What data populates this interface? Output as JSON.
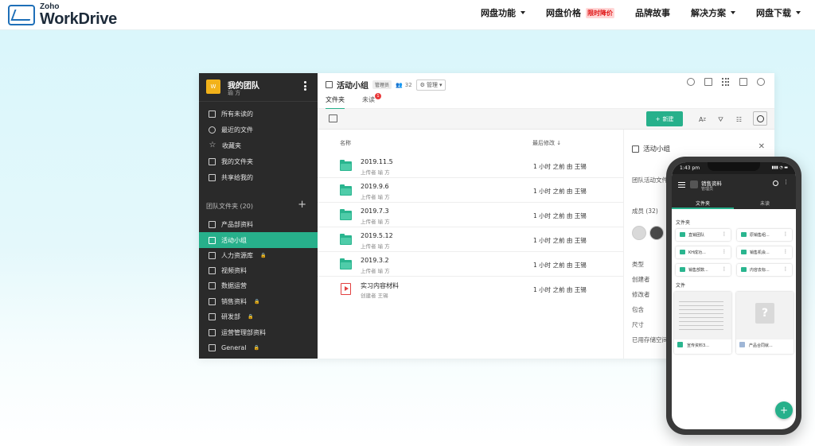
{
  "header": {
    "logo_small": "Zoho",
    "logo_big": "WorkDrive",
    "nav": [
      {
        "label": "网盘功能",
        "has_caret": true
      },
      {
        "label": "网盘价格",
        "badge": "限时降价"
      },
      {
        "label": "品牌故事"
      },
      {
        "label": "解决方案",
        "has_caret": true
      },
      {
        "label": "网盘下载",
        "has_caret": true
      }
    ]
  },
  "app": {
    "team": {
      "avatar": "W",
      "name": "我的团队",
      "sub": "瑜 方"
    },
    "sidebar_items": [
      {
        "label": "所有未读的",
        "icon": "inbox-icon"
      },
      {
        "label": "最近的文件",
        "icon": "clock-icon"
      },
      {
        "label": "收藏夹",
        "icon": "star-icon"
      },
      {
        "label": "我的文件夹",
        "icon": "folder-icon"
      },
      {
        "label": "共享给我的",
        "icon": "share-icon"
      }
    ],
    "team_section": "团队文件夹 (20)",
    "team_folders": [
      {
        "label": "产品部资料",
        "locked": false
      },
      {
        "label": "活动小组",
        "locked": false,
        "active": true
      },
      {
        "label": "人力资源库",
        "locked": true
      },
      {
        "label": "视频资料",
        "locked": false
      },
      {
        "label": "数据运营",
        "locked": false
      },
      {
        "label": "销售资料",
        "locked": true
      },
      {
        "label": "研发部",
        "locked": true
      },
      {
        "label": "运营管理部资料",
        "locked": false
      },
      {
        "label": "General",
        "locked": true
      }
    ],
    "main": {
      "title": "活动小组",
      "role_tag": "管理员",
      "member_count": "32",
      "manage_label": "管理",
      "tabs": [
        {
          "label": "文件夹",
          "active": true
        },
        {
          "label": "未读",
          "badge": "1"
        }
      ],
      "new_button": "新建",
      "col_name": "名称",
      "col_modified": "最后修改",
      "rows": [
        {
          "name": "2019.11.5",
          "sub": "上传者 瑜 方",
          "modified": "1 小时 之前 由 王锡",
          "type": "folder"
        },
        {
          "name": "2019.9.6",
          "sub": "上传者 瑜 方",
          "modified": "1 小时 之前 由 王锡",
          "type": "folder"
        },
        {
          "name": "2019.7.3",
          "sub": "上传者 瑜 方",
          "modified": "1 小时 之前 由 王锡",
          "type": "folder"
        },
        {
          "name": "2019.5.12",
          "sub": "上传者 瑜 方",
          "modified": "1 小时 之前 由 王锡",
          "type": "folder"
        },
        {
          "name": "2019.3.2",
          "sub": "上传者 瑜 方",
          "modified": "1 小时 之前 由 王锡",
          "type": "folder"
        },
        {
          "name": "实习内容材料",
          "sub": "创建者 王锡",
          "modified": "1 小时 之前 由 王锡",
          "type": "video"
        }
      ]
    },
    "detail": {
      "title": "活动小组",
      "desc": "团队活动文件",
      "members": "成员 (32)",
      "fields": [
        "类型",
        "创建者",
        "修改者",
        "包含",
        "尺寸",
        "已用存储空间"
      ]
    }
  },
  "phone": {
    "time": "1:43 pm",
    "signal": "▮▮▮ ◔ ▬",
    "title": "销售资料",
    "sub": "管理员",
    "tabs": [
      {
        "label": "文件夹",
        "active": true
      },
      {
        "label": "未读"
      }
    ],
    "folders_label": "文件夹",
    "folders": [
      "直销团队",
      "原销售组...",
      "KH成功...",
      "销售机会...",
      "销售部数...",
      "内容去标..."
    ],
    "files_label": "文件",
    "files": [
      {
        "name": "宣传资料3...",
        "kind": "doc"
      },
      {
        "name": "产品合同就...",
        "kind": "unknown"
      }
    ],
    "fab": "+"
  },
  "colors": {
    "accent": "#27b08b",
    "sidebar": "#2a2a2a",
    "brand": "#1e6fb8"
  }
}
